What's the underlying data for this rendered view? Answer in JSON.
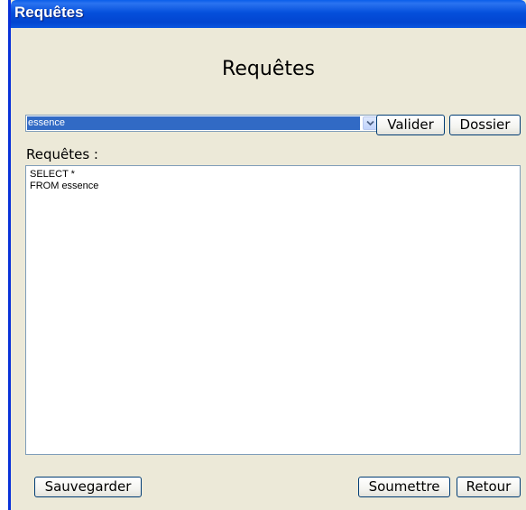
{
  "window": {
    "title": "Requêtes"
  },
  "heading": "Requêtes",
  "query_select": {
    "selected": "essence"
  },
  "buttons": {
    "valider": "Valider",
    "dossier": "Dossier",
    "sauvegarder": "Sauvegarder",
    "soumettre": "Soumettre",
    "retour": "Retour"
  },
  "query_label": "Requêtes :",
  "query_text": [
    "SELECT *",
    "FROM essence"
  ],
  "colors": {
    "titlebar": "#0a5eea",
    "window_bg": "#ece9d8",
    "selection": "#316ac5"
  }
}
